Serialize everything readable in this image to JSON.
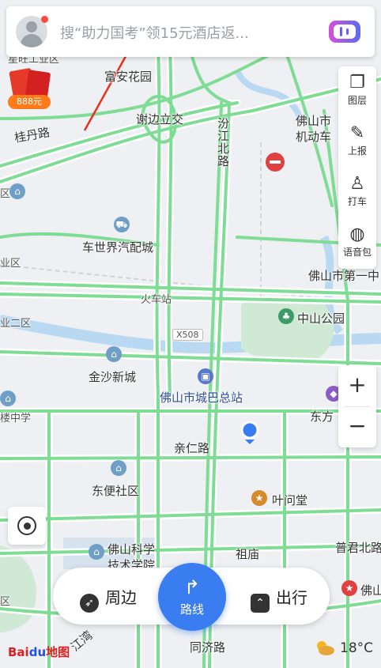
{
  "search": {
    "placeholder": "搜“助力国考”领15元酒店返..."
  },
  "right_tools": [
    {
      "label": "图层",
      "icon": "layers-icon"
    },
    {
      "label": "上报",
      "icon": "report-icon"
    },
    {
      "label": "打车",
      "icon": "taxi-icon"
    },
    {
      "label": "语音包",
      "icon": "voice-pack-icon"
    }
  ],
  "zoom": {
    "in": "+",
    "out": "−"
  },
  "promo": {
    "amount": "888元"
  },
  "map_labels": {
    "road_guidan": "桂丹路",
    "interchange_xiebian": "谢边立交",
    "fuan_garden": "富安花园",
    "fenjiang_north_road": "汾江北路",
    "foshan_vehicle_top": "佛山市",
    "foshan_vehicle_bottom": "机动车",
    "cheshijie": "车世界汽配城",
    "train_station": "火车站",
    "foshan_no1": "佛山市第一中",
    "zhongshan_park": "中山公园",
    "x508": "X508",
    "jinsha_new_city": "金沙新城",
    "foshan_bus_station": "佛山市城巴总站",
    "dongfang": "东方",
    "qinren_road": "亲仁路",
    "dongbian_community": "东便社区",
    "yewentang": "叶问堂",
    "zumiao": "祖庙",
    "pujun_north_road": "普君北路",
    "foshan_science_1": "佛山科学",
    "foshan_science_2": "技术学院",
    "tongji_road": "同济路",
    "jiangwan": "江湾",
    "industrial_zone_top": "星旺工业区",
    "zone_left": "区",
    "zone_left2": "业区",
    "zone_left3": "业二区",
    "middle_school": "楼中学",
    "foshan_right": "佛山",
    "zone_bottom": "区"
  },
  "bottom_bar": {
    "nearby": "周边",
    "route": "路线",
    "travel": "出行"
  },
  "footer": {
    "logo_bai": "Bai",
    "logo_du": "du",
    "logo_map": "地图",
    "temperature": "18°C"
  },
  "colors": {
    "road": "#7fdc94",
    "road_edge": "#ffffff",
    "water": "#b9d9f2",
    "park": "#cfe9d4",
    "accent": "#3a7df0"
  }
}
